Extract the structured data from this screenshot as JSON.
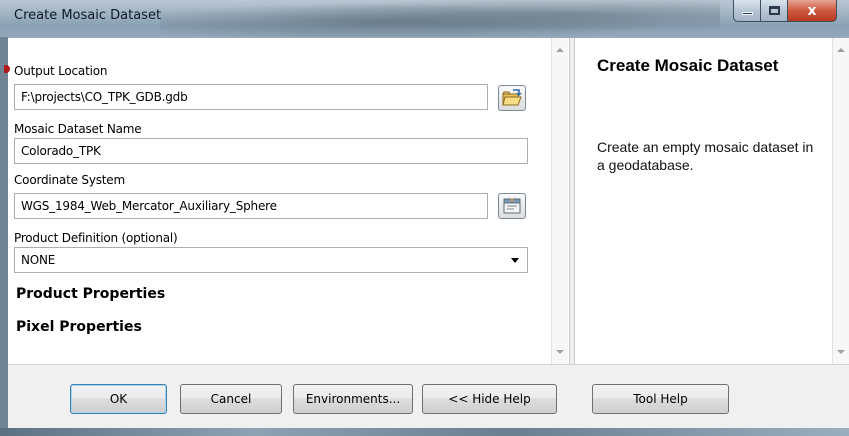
{
  "window": {
    "title": "Create Mosaic Dataset",
    "controls": {
      "minimize": "minimize",
      "maximize": "maximize",
      "close": "x"
    }
  },
  "params": {
    "output_location": {
      "label": "Output Location",
      "value": "F:\\projects\\CO_TPK_GDB.gdb"
    },
    "mosaic_name": {
      "label": "Mosaic Dataset Name",
      "value": "Colorado_TPK"
    },
    "coordinate_system": {
      "label": "Coordinate System",
      "value": "WGS_1984_Web_Mercator_Auxiliary_Sphere"
    },
    "product_definition": {
      "label": "Product Definition (optional)",
      "value": "NONE"
    },
    "sections": [
      "Product Properties",
      "Pixel Properties"
    ]
  },
  "help": {
    "title": "Create Mosaic Dataset",
    "body": "Create an empty mosaic dataset in a geodatabase."
  },
  "buttons": {
    "ok": "OK",
    "cancel": "Cancel",
    "environments": "Environments...",
    "hide_help": "<< Hide Help",
    "tool_help": "Tool Help"
  },
  "icons": {
    "folder": "open-folder-icon",
    "coordinate": "spatial-reference-icon",
    "dropdown": "chevron-down-icon"
  },
  "colors": {
    "accent_button_border": "#3c7fb1",
    "close_button": "#c7472d",
    "required_marker": "#b31919"
  }
}
